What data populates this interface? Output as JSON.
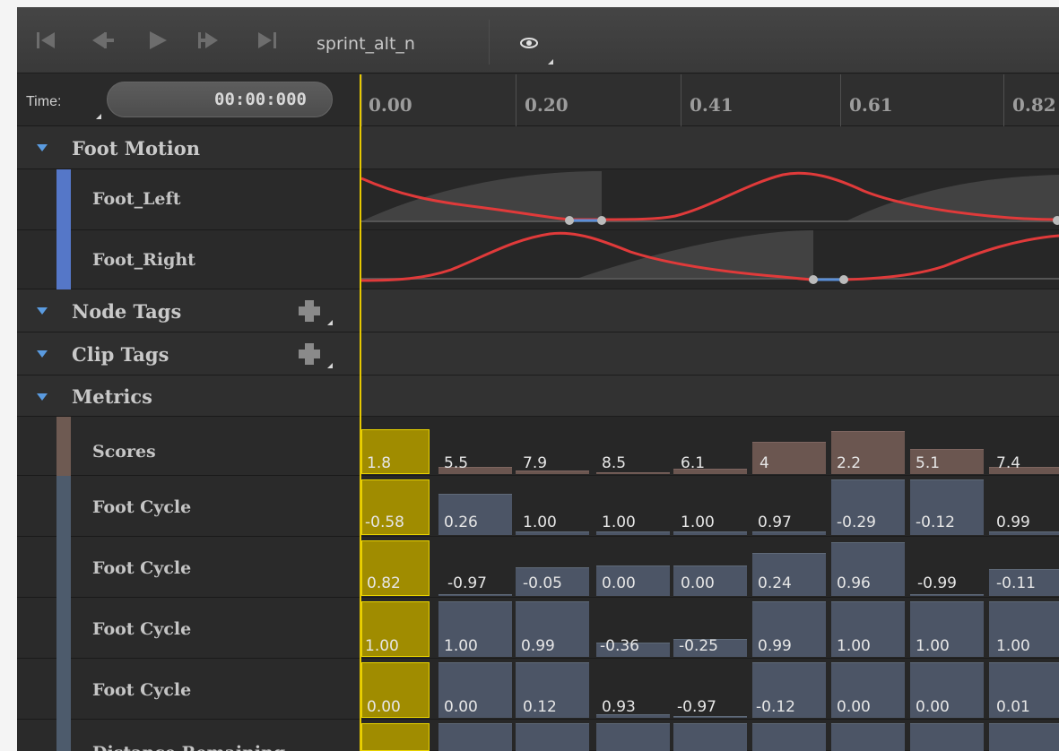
{
  "toolbar": {
    "clip_name": "sprint_alt_n",
    "buttons": [
      {
        "name": "go-to-start-icon"
      },
      {
        "name": "step-back-icon"
      },
      {
        "name": "play-icon"
      },
      {
        "name": "step-forward-icon"
      },
      {
        "name": "go-to-end-icon"
      }
    ],
    "visibility_icon": "eye-icon"
  },
  "time": {
    "label": "Time:",
    "value": "00:00:000"
  },
  "ruler": {
    "ticks": [
      "0.00",
      "0.20",
      "0.41",
      "0.61",
      "0.82"
    ]
  },
  "tree": {
    "foot_motion": {
      "label": "Foot Motion",
      "tracks": [
        "Foot_Left",
        "Foot_Right"
      ]
    },
    "node_tags": {
      "label": "Node Tags"
    },
    "clip_tags": {
      "label": "Clip Tags"
    },
    "metrics": {
      "label": "Metrics",
      "tracks": [
        "Scores",
        "Foot Cycle",
        "Foot Cycle",
        "Foot Cycle",
        "Foot Cycle",
        "Distance Remaining"
      ]
    }
  },
  "metrics_values": {
    "scores": [
      "1.8",
      "5.5",
      "7.9",
      "8.5",
      "6.1",
      "4",
      "2.2",
      "5.1",
      "7.4"
    ],
    "foot_cycle_1": [
      "-0.58",
      "0.26",
      "1.00",
      "1.00",
      "1.00",
      "0.97",
      "-0.29",
      "-0.12",
      "0.99"
    ],
    "foot_cycle_2": [
      "0.82",
      "-0.97",
      "-0.05",
      "0.00",
      "0.00",
      "0.24",
      "0.96",
      "-0.99",
      "-0.11"
    ],
    "foot_cycle_3": [
      "1.00",
      "1.00",
      "0.99",
      "-0.36",
      "-0.25",
      "0.99",
      "1.00",
      "1.00",
      "1.00"
    ],
    "foot_cycle_4": [
      "0.00",
      "0.00",
      "0.12",
      "0.93",
      "-0.97",
      "-0.12",
      "0.00",
      "0.00",
      "0.01"
    ]
  },
  "colors": {
    "curve": "#e03a3a",
    "cursor": "#e6c800",
    "selected_cell": "#a08c00",
    "score_cell": "#6b5650",
    "cycle_cell": "#4c5566",
    "group_arrow": "#5a9be0",
    "foot_stripe": "#5577c8"
  }
}
